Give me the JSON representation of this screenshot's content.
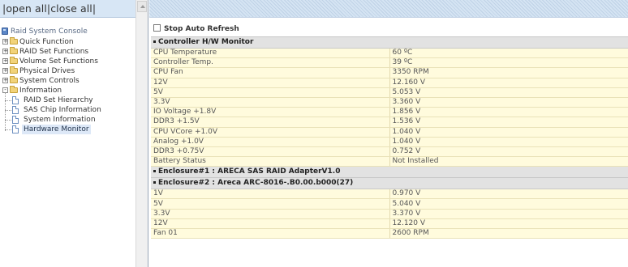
{
  "nav": {
    "open_all": "open all",
    "close_all": "close all",
    "sep_left": "|",
    "sep_mid": "|",
    "sep_right": "|"
  },
  "tree": {
    "root": "Raid System Console",
    "folders": [
      {
        "label": "Quick Function",
        "state": "+"
      },
      {
        "label": "RAID Set Functions",
        "state": "+"
      },
      {
        "label": "Volume Set Functions",
        "state": "+"
      },
      {
        "label": "Physical Drives",
        "state": "+"
      },
      {
        "label": "System Controls",
        "state": "+"
      },
      {
        "label": "Information",
        "state": "-"
      }
    ],
    "pages": [
      {
        "label": "RAID Set Hierarchy"
      },
      {
        "label": "SAS Chip Information"
      },
      {
        "label": "System Information"
      },
      {
        "label": "Hardware Monitor"
      }
    ]
  },
  "main": {
    "refresh_label": "Stop Auto Refresh",
    "sections": [
      {
        "title": "Controller H/W Monitor",
        "rows": [
          {
            "name": "CPU Temperature",
            "value": "60 ºC"
          },
          {
            "name": "Controller Temp.",
            "value": "39 ºC"
          },
          {
            "name": "CPU Fan",
            "value": "3350 RPM"
          },
          {
            "name": "12V",
            "value": "12.160 V"
          },
          {
            "name": "5V",
            "value": "5.053 V"
          },
          {
            "name": "3.3V",
            "value": "3.360 V"
          },
          {
            "name": "IO Voltage +1.8V",
            "value": "1.856 V"
          },
          {
            "name": "DDR3 +1.5V",
            "value": "1.536 V"
          },
          {
            "name": "CPU VCore +1.0V",
            "value": "1.040 V"
          },
          {
            "name": "Analog +1.0V",
            "value": "1.040 V"
          },
          {
            "name": "DDR3 +0.75V",
            "value": "0.752 V"
          },
          {
            "name": "Battery Status",
            "value": "Not Installed"
          }
        ]
      },
      {
        "title": "Enclosure#1 : ARECA SAS RAID AdapterV1.0",
        "rows": []
      },
      {
        "title": "Enclosure#2 : Areca ARC-8016-.B0.00.b000(27)",
        "rows": [
          {
            "name": "1V",
            "value": "0.970 V"
          },
          {
            "name": "5V",
            "value": "5.040 V"
          },
          {
            "name": "3.3V",
            "value": "3.370 V"
          },
          {
            "name": "12V",
            "value": "12.120 V"
          },
          {
            "name": "Fan 01",
            "value": "2600 RPM"
          }
        ]
      }
    ]
  }
}
